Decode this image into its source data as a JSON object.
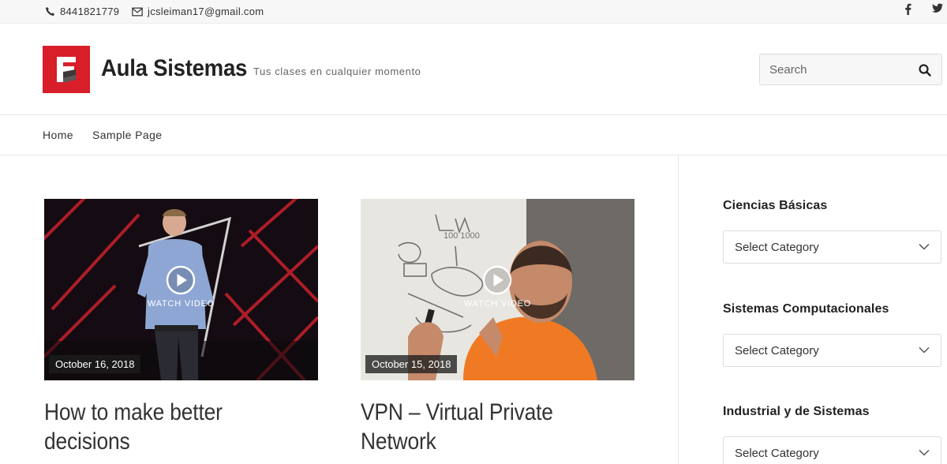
{
  "topbar": {
    "phone": "8441821779",
    "email": "jcsleiman17@gmail.com",
    "social": [
      "facebook-icon",
      "twitter-icon"
    ]
  },
  "header": {
    "site_title": "Aula Sistemas",
    "tagline": "Tus clases en cualquier momento",
    "logo_color": "#d81e29",
    "search": {
      "placeholder": "Search",
      "icon": "search-icon"
    }
  },
  "nav": {
    "items": [
      {
        "label": "Home"
      },
      {
        "label": "Sample Page"
      }
    ]
  },
  "posts": [
    {
      "date": "October 16, 2018",
      "watch_label": "WATCH VIDEO",
      "title_line1": "How to make better",
      "title_line2": "decisions"
    },
    {
      "date": "October 15, 2018",
      "watch_label": "WATCH VIDEO",
      "title_line1": "VPN – Virtual Private",
      "title_line2": "Network"
    }
  ],
  "sidebar": {
    "widgets": [
      {
        "title": "Ciencias Básicas",
        "select_value": "Select Category"
      },
      {
        "title": "Sistemas Computacionales",
        "select_value": "Select Category"
      },
      {
        "title": "Industrial y de Sistemas",
        "select_value": "Select Category"
      }
    ]
  }
}
